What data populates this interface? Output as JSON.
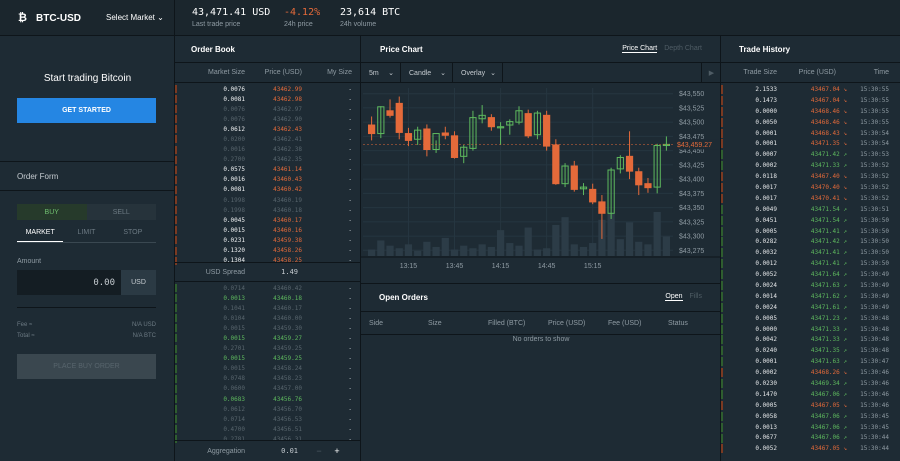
{
  "header": {
    "product": "BTC-USD",
    "select_market": "Select Market",
    "last_price": "43,471.41 USD",
    "last_price_label": "Last trade price",
    "change": "-4.12%",
    "change_label": "24h price",
    "volume": "23,614 BTC",
    "volume_label": "24h volume"
  },
  "left": {
    "hero": "Start trading Bitcoin",
    "cta": "GET STARTED",
    "order_form": "Order Form",
    "buy": "BUY",
    "sell": "SELL",
    "tabs": [
      "MARKET",
      "LIMIT",
      "STOP"
    ],
    "amount_label": "Amount",
    "amount_value": "0.00",
    "amount_unit": "USD",
    "fee_label": "Fee ≈",
    "fee_value": "N/A USD",
    "total_label": "Total ≈",
    "total_value": "N/A BTC",
    "place": "PLACE BUY ORDER"
  },
  "orderbook": {
    "title": "Order Book",
    "col_size": "Market Size",
    "col_price": "Price (USD)",
    "col_my": "My Size",
    "spread_label": "USD Spread",
    "spread_value": "1.49",
    "agg_label": "Aggregation",
    "agg_value": "0.01",
    "asks": [
      [
        "0.0076",
        "43462.99",
        "b"
      ],
      [
        "0.0081",
        "43462.98",
        "b"
      ],
      [
        "0.0076",
        "43462.97",
        "d"
      ],
      [
        "0.0076",
        "43462.90",
        "d"
      ],
      [
        "0.0612",
        "43462.43",
        "b"
      ],
      [
        "0.0200",
        "43462.41",
        "d"
      ],
      [
        "0.0016",
        "43462.38",
        "d"
      ],
      [
        "0.2700",
        "43462.35",
        "d"
      ],
      [
        "0.0575",
        "43461.14",
        "b"
      ],
      [
        "0.0016",
        "43460.43",
        "b"
      ],
      [
        "0.0081",
        "43460.42",
        "b"
      ],
      [
        "0.1998",
        "43460.19",
        "d"
      ],
      [
        "0.1998",
        "43460.18",
        "d"
      ],
      [
        "0.0045",
        "43460.17",
        "b"
      ],
      [
        "0.0015",
        "43460.16",
        "b"
      ],
      [
        "0.0231",
        "43459.38",
        "b"
      ],
      [
        "0.1320",
        "43458.26",
        "b"
      ],
      [
        "0.1304",
        "43458.25",
        "b"
      ]
    ],
    "bids": [
      [
        "0.0714",
        "43460.42",
        "d"
      ],
      [
        "0.0013",
        "43460.18",
        "b"
      ],
      [
        "0.1041",
        "43460.17",
        "d"
      ],
      [
        "0.0104",
        "43460.00",
        "d"
      ],
      [
        "0.0015",
        "43459.30",
        "d"
      ],
      [
        "0.0015",
        "43459.27",
        "b"
      ],
      [
        "0.2701",
        "43459.25",
        "d"
      ],
      [
        "0.0015",
        "43459.25",
        "b"
      ],
      [
        "0.0015",
        "43458.24",
        "d"
      ],
      [
        "0.0748",
        "43458.23",
        "d"
      ],
      [
        "0.0600",
        "43457.00",
        "d"
      ],
      [
        "0.0683",
        "43456.76",
        "b"
      ],
      [
        "0.0612",
        "43456.70",
        "d"
      ],
      [
        "0.0714",
        "43456.53",
        "d"
      ],
      [
        "0.4700",
        "43456.51",
        "d"
      ],
      [
        "0.2781",
        "43456.31",
        "d"
      ]
    ]
  },
  "chart": {
    "title": "Price Chart",
    "toggle_on": "Price Chart",
    "toggle_off": "Depth Chart",
    "interval": "5m",
    "style": "Candle",
    "overlay": "Overlay",
    "current_price_tag": "$43,459.27"
  },
  "chart_data": {
    "type": "candlestick",
    "x_ticks": [
      "13:15",
      "13:45",
      "14:15",
      "14:45",
      "15:15"
    ],
    "y_ticks": [
      "$43,550",
      "$43,525",
      "$43,500",
      "$43,475",
      "$43,450",
      "$43,425",
      "$43,400",
      "$43,375",
      "$43,350",
      "$43,325",
      "$43,300",
      "$43,275"
    ],
    "ylim": [
      43265,
      43560
    ],
    "candles": [
      {
        "o": 43495,
        "h": 43510,
        "l": 43468,
        "c": 43480
      },
      {
        "o": 43480,
        "h": 43528,
        "l": 43472,
        "c": 43527
      },
      {
        "o": 43520,
        "h": 43540,
        "l": 43508,
        "c": 43512
      },
      {
        "o": 43533,
        "h": 43545,
        "l": 43470,
        "c": 43482
      },
      {
        "o": 43480,
        "h": 43490,
        "l": 43458,
        "c": 43468
      },
      {
        "o": 43470,
        "h": 43492,
        "l": 43460,
        "c": 43486
      },
      {
        "o": 43488,
        "h": 43496,
        "l": 43440,
        "c": 43452
      },
      {
        "o": 43452,
        "h": 43468,
        "l": 43446,
        "c": 43480
      },
      {
        "o": 43481,
        "h": 43492,
        "l": 43470,
        "c": 43477
      },
      {
        "o": 43476,
        "h": 43484,
        "l": 43436,
        "c": 43438
      },
      {
        "o": 43440,
        "h": 43460,
        "l": 43428,
        "c": 43456
      },
      {
        "o": 43454,
        "h": 43520,
        "l": 43450,
        "c": 43508
      },
      {
        "o": 43506,
        "h": 43530,
        "l": 43498,
        "c": 43512
      },
      {
        "o": 43508,
        "h": 43514,
        "l": 43485,
        "c": 43492
      },
      {
        "o": 43490,
        "h": 43500,
        "l": 43460,
        "c": 43492
      },
      {
        "o": 43495,
        "h": 43505,
        "l": 43478,
        "c": 43501
      },
      {
        "o": 43500,
        "h": 43528,
        "l": 43496,
        "c": 43520
      },
      {
        "o": 43515,
        "h": 43522,
        "l": 43472,
        "c": 43476
      },
      {
        "o": 43478,
        "h": 43520,
        "l": 43470,
        "c": 43516
      },
      {
        "o": 43512,
        "h": 43520,
        "l": 43450,
        "c": 43458
      },
      {
        "o": 43460,
        "h": 43470,
        "l": 43390,
        "c": 43392
      },
      {
        "o": 43392,
        "h": 43428,
        "l": 43386,
        "c": 43423
      },
      {
        "o": 43423,
        "h": 43432,
        "l": 43378,
        "c": 43382
      },
      {
        "o": 43383,
        "h": 43393,
        "l": 43372,
        "c": 43386
      },
      {
        "o": 43382,
        "h": 43392,
        "l": 43356,
        "c": 43360
      },
      {
        "o": 43360,
        "h": 43372,
        "l": 43295,
        "c": 43340
      },
      {
        "o": 43340,
        "h": 43420,
        "l": 43330,
        "c": 43416
      },
      {
        "o": 43418,
        "h": 43442,
        "l": 43410,
        "c": 43438
      },
      {
        "o": 43440,
        "h": 43484,
        "l": 43400,
        "c": 43414
      },
      {
        "o": 43413,
        "h": 43420,
        "l": 43372,
        "c": 43390
      },
      {
        "o": 43392,
        "h": 43402,
        "l": 43376,
        "c": 43385
      },
      {
        "o": 43386,
        "h": 43462,
        "l": 43375,
        "c": 43459
      },
      {
        "o": 43459,
        "h": 43475,
        "l": 43450,
        "c": 43461
      }
    ],
    "volume": [
      5,
      12,
      8,
      6,
      9,
      4,
      11,
      7,
      14,
      5,
      8,
      6,
      9,
      7,
      20,
      10,
      8,
      22,
      5,
      6,
      24,
      30,
      9,
      7,
      10,
      28,
      33,
      13,
      26,
      11,
      9,
      34,
      15
    ]
  },
  "orders": {
    "title": "Open Orders",
    "toggle_on": "Open",
    "toggle_off": "Fills",
    "cols": [
      "Side",
      "Size",
      "Filled (BTC)",
      "Price (USD)",
      "Fee (USD)",
      "Status"
    ],
    "empty": "No orders to show"
  },
  "history": {
    "title": "Trade History",
    "col_size": "Trade Size",
    "col_price": "Price (USD)",
    "col_time": "Time",
    "rows": [
      [
        "2.1533",
        "43467.04",
        "down",
        "15:30:55"
      ],
      [
        "0.1473",
        "43467.04",
        "down",
        "15:30:55"
      ],
      [
        "0.0000",
        "43468.46",
        "down",
        "15:30:55"
      ],
      [
        "0.0050",
        "43468.46",
        "down",
        "15:30:55"
      ],
      [
        "0.0001",
        "43468.43",
        "down",
        "15:30:54"
      ],
      [
        "0.0001",
        "43471.35",
        "down",
        "15:30:54"
      ],
      [
        "0.0007",
        "43471.42",
        "up",
        "15:30:53"
      ],
      [
        "0.0002",
        "43471.33",
        "up",
        "15:30:52"
      ],
      [
        "0.0118",
        "43467.40",
        "down",
        "15:30:52"
      ],
      [
        "0.0017",
        "43470.40",
        "down",
        "15:30:52"
      ],
      [
        "0.0017",
        "43470.41",
        "down",
        "15:30:52"
      ],
      [
        "0.0049",
        "43471.54",
        "up",
        "15:30:51"
      ],
      [
        "0.0451",
        "43471.54",
        "up",
        "15:30:50"
      ],
      [
        "0.0005",
        "43471.41",
        "up",
        "15:30:50"
      ],
      [
        "0.0282",
        "43471.42",
        "up",
        "15:30:50"
      ],
      [
        "0.0032",
        "43471.41",
        "up",
        "15:30:50"
      ],
      [
        "0.0012",
        "43471.41",
        "up",
        "15:30:50"
      ],
      [
        "0.0052",
        "43471.64",
        "up",
        "15:30:49"
      ],
      [
        "0.0024",
        "43471.63",
        "up",
        "15:30:49"
      ],
      [
        "0.0014",
        "43471.62",
        "up",
        "15:30:49"
      ],
      [
        "0.0024",
        "43471.61",
        "up",
        "15:30:49"
      ],
      [
        "0.0005",
        "43471.23",
        "up",
        "15:30:48"
      ],
      [
        "0.0000",
        "43471.33",
        "up",
        "15:30:48"
      ],
      [
        "0.0042",
        "43471.33",
        "up",
        "15:30:48"
      ],
      [
        "0.0240",
        "43471.35",
        "up",
        "15:30:48"
      ],
      [
        "0.0001",
        "43471.63",
        "up",
        "15:30:47"
      ],
      [
        "0.0002",
        "43468.26",
        "down",
        "15:30:46"
      ],
      [
        "0.0230",
        "43469.34",
        "up",
        "15:30:46"
      ],
      [
        "0.1470",
        "43467.06",
        "up",
        "15:30:46"
      ],
      [
        "0.0005",
        "43467.05",
        "down",
        "15:30:46"
      ],
      [
        "0.0058",
        "43467.06",
        "up",
        "15:30:45"
      ],
      [
        "0.0013",
        "43467.06",
        "up",
        "15:30:45"
      ],
      [
        "0.0677",
        "43467.06",
        "up",
        "15:30:44"
      ],
      [
        "0.0052",
        "43467.05",
        "down",
        "15:30:44"
      ]
    ]
  },
  "colors": {
    "up": "#5eb95e",
    "down": "#e46a3a",
    "accent": "#2586e3"
  }
}
